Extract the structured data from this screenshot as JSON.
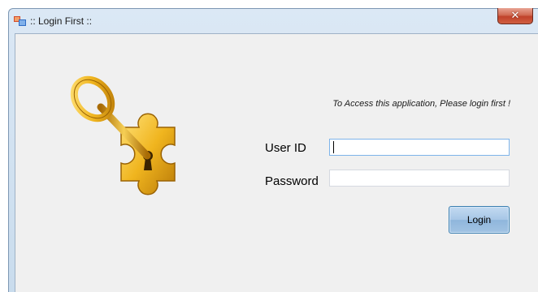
{
  "window": {
    "title": ":: Login First ::",
    "close_glyph": "✕",
    "icon": "app-window-icon"
  },
  "illustration": {
    "icon": "key-puzzle-icon",
    "accent": "#e6b21f"
  },
  "form": {
    "info_text": "To Access this application, Please login first !",
    "user_id_label": "User ID",
    "user_id_value": "",
    "password_label": "Password",
    "password_value": "",
    "login_label": "Login"
  },
  "colors": {
    "titlebar": "#dbe8f5",
    "client_bg": "#f0f0f0",
    "close_red": "#c0412a",
    "login_button": "#a6c6e6",
    "focus_border": "#7eb4ea"
  }
}
